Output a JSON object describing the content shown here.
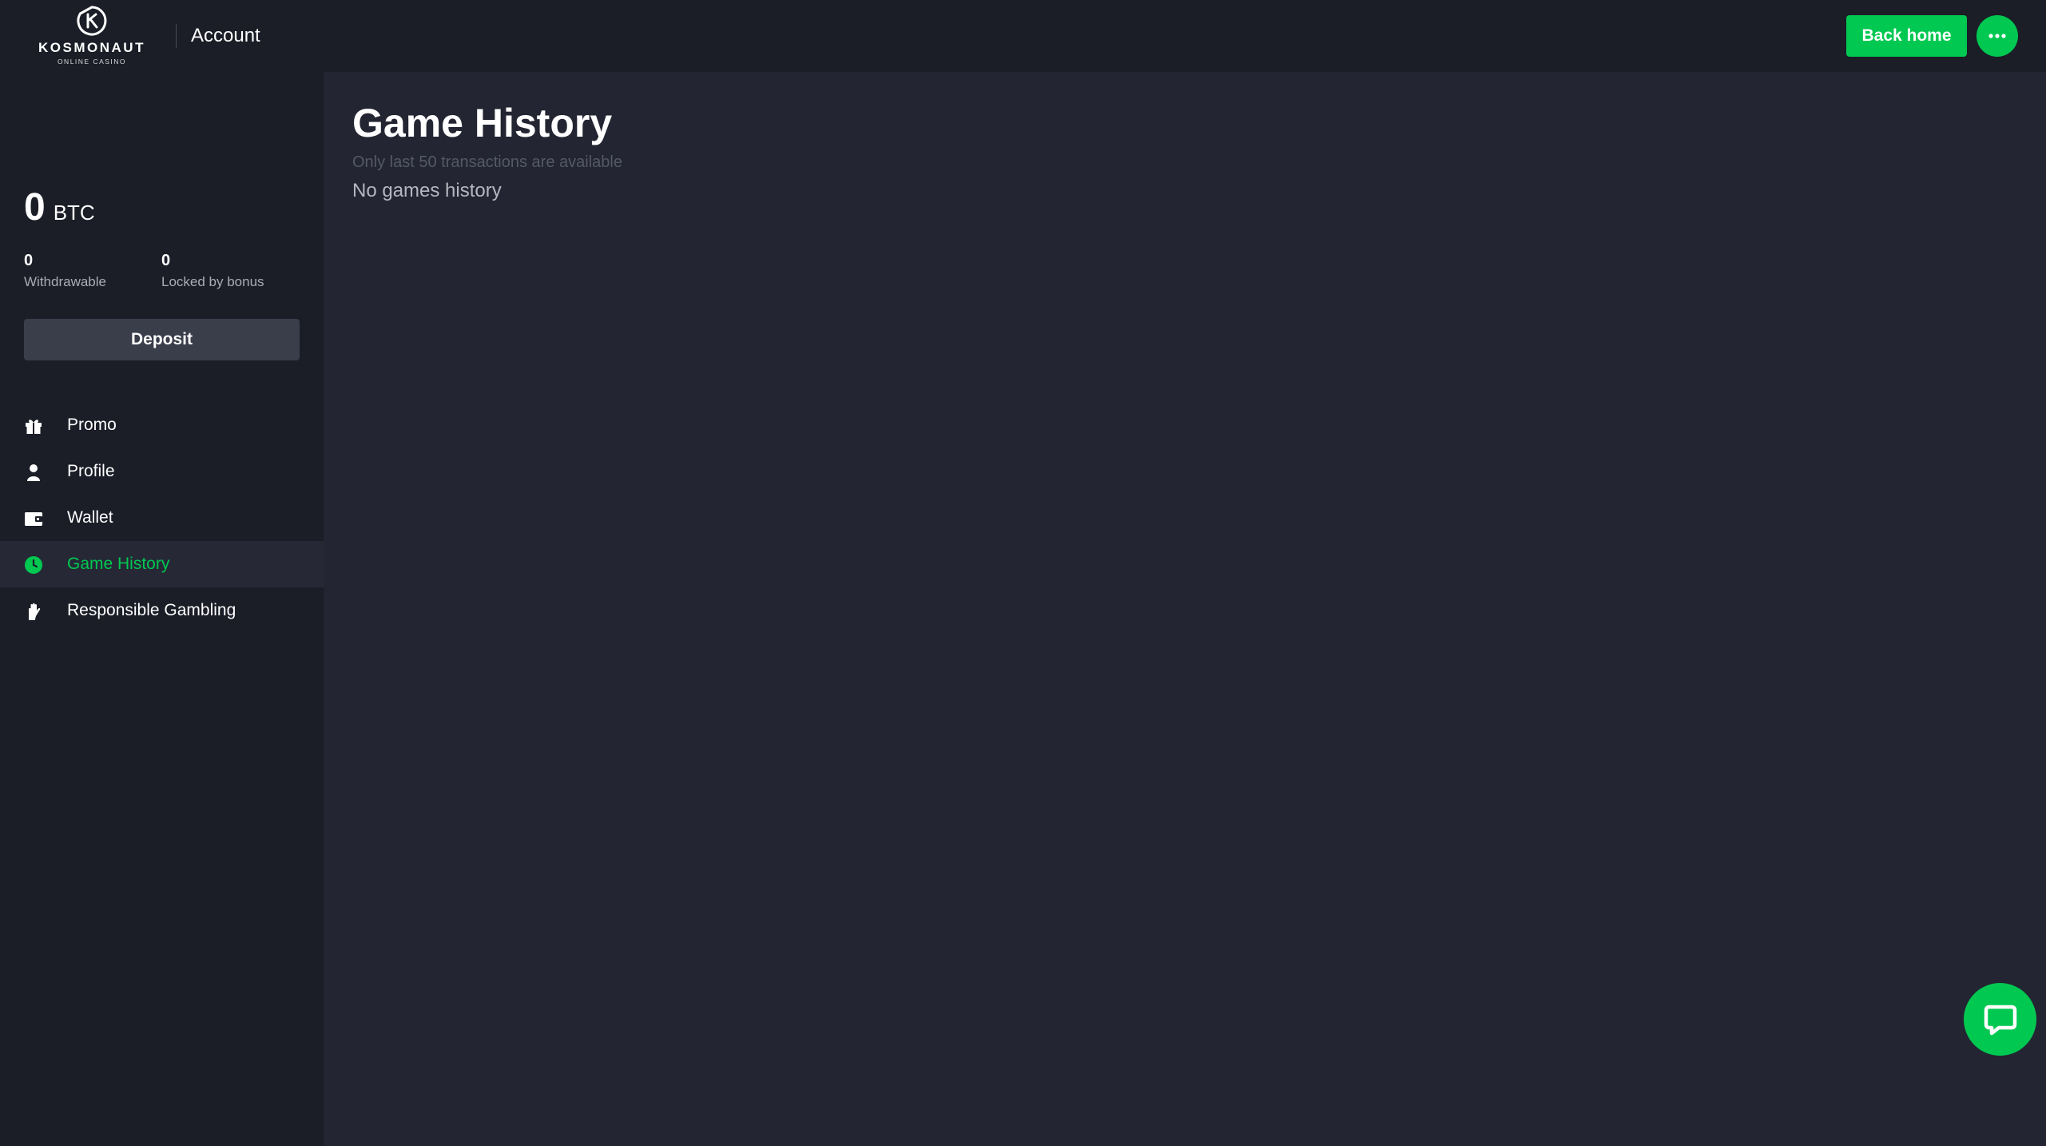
{
  "header": {
    "logo": {
      "name": "KOSMONAUT",
      "tagline": "ONLINE CASINO"
    },
    "section_title": "Account",
    "back_home_label": "Back home",
    "more_icon": "more-dots-icon"
  },
  "sidebar": {
    "balance": {
      "amount": "0",
      "currency": "BTC"
    },
    "stats": [
      {
        "value": "0",
        "label": "Withdrawable"
      },
      {
        "value": "0",
        "label": "Locked by bonus"
      }
    ],
    "deposit_label": "Deposit",
    "nav": [
      {
        "label": "Promo",
        "icon": "gift-icon",
        "active": false
      },
      {
        "label": "Profile",
        "icon": "user-icon",
        "active": false
      },
      {
        "label": "Wallet",
        "icon": "wallet-icon",
        "active": false
      },
      {
        "label": "Game History",
        "icon": "clock-icon",
        "active": true
      },
      {
        "label": "Responsible Gambling",
        "icon": "hand-icon",
        "active": false
      }
    ]
  },
  "main": {
    "title": "Game History",
    "note": "Only last 50 transactions are available",
    "empty_message": "No games history"
  },
  "chat": {
    "icon": "chat-bubble-icon"
  },
  "colors": {
    "accent": "#00c851",
    "background": "#1b1d27",
    "panel": "#232532",
    "active_row": "#262836",
    "button_dark": "#3a3d4a"
  }
}
